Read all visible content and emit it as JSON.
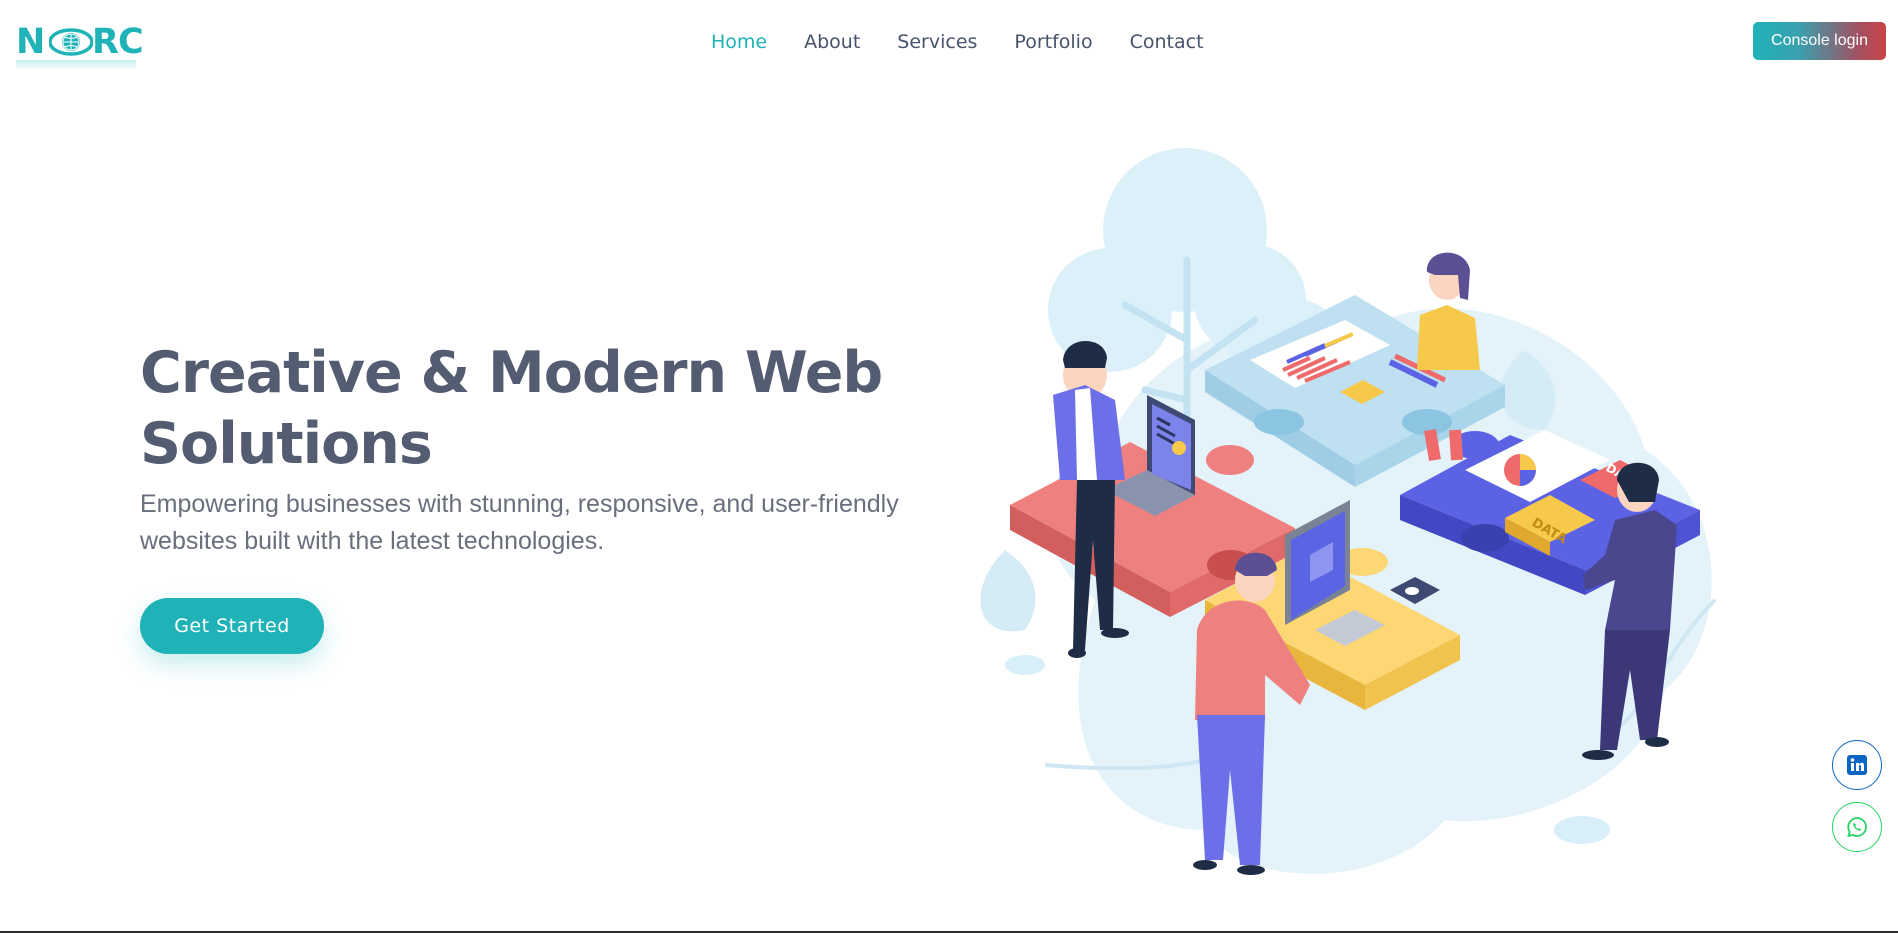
{
  "header": {
    "logo_text": "NORC",
    "nav": [
      {
        "label": "Home",
        "active": true
      },
      {
        "label": "About",
        "active": false
      },
      {
        "label": "Services",
        "active": false
      },
      {
        "label": "Portfolio",
        "active": false
      },
      {
        "label": "Contact",
        "active": false
      }
    ],
    "console_login_label": "Console login"
  },
  "hero": {
    "title": "Creative & Modern Web Solutions",
    "subtitle": "Empowering businesses with stunning, responsive, and user-friendly websites built with the latest technologies.",
    "cta_label": "Get Started",
    "illustration_tags": [
      "DATA",
      "DATA"
    ]
  },
  "social": {
    "linkedin_icon": "linkedin-icon",
    "whatsapp_icon": "whatsapp-icon"
  },
  "colors": {
    "accent": "#1fb3b8",
    "heading": "#545c72",
    "nav_text": "#47536b"
  }
}
